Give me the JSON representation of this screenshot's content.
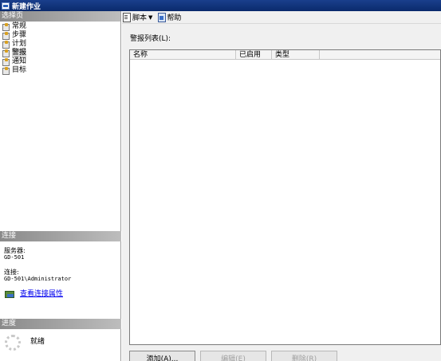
{
  "window": {
    "title": "新建作业"
  },
  "left_panel": {
    "select_page_header": "选择页",
    "pages": [
      {
        "label": "常规",
        "selected": false
      },
      {
        "label": "步骤",
        "selected": false
      },
      {
        "label": "计划",
        "selected": false
      },
      {
        "label": "警报",
        "selected": true
      },
      {
        "label": "通知",
        "selected": false
      },
      {
        "label": "目标",
        "selected": false
      }
    ],
    "connection": {
      "header": "连接",
      "server_label": "服务器:",
      "server_value": "GD-501",
      "connection_label": "连接:",
      "connection_value": "GD-501\\Administrator",
      "view_link": "查看连接属性"
    },
    "progress": {
      "header": "进度",
      "status": "就绪"
    }
  },
  "toolbar": {
    "script_label": "脚本",
    "help_label": "帮助"
  },
  "main": {
    "alert_list_label": "警报列表(L):",
    "columns": [
      "名称",
      "已启用",
      "类型"
    ],
    "rows": [],
    "buttons": {
      "add": "添加(A)...",
      "edit": "编辑(E)",
      "remove": "删除(R)"
    }
  }
}
